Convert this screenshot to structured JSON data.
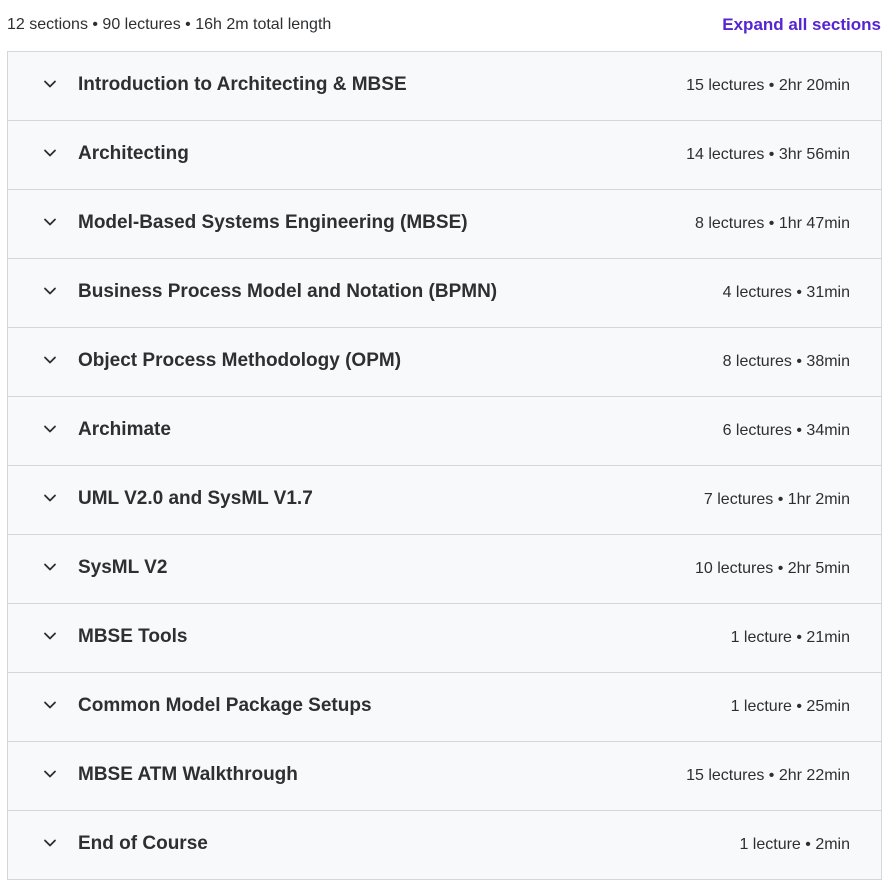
{
  "curriculum": {
    "summary": "12 sections • 90 lectures • 16h 2m total length",
    "expand_label": "Expand all sections",
    "sections": [
      {
        "title": "Introduction to Architecting & MBSE",
        "meta": "15 lectures • 2hr 20min"
      },
      {
        "title": "Architecting",
        "meta": "14 lectures • 3hr 56min"
      },
      {
        "title": "Model-Based Systems Engineering (MBSE)",
        "meta": "8 lectures • 1hr 47min"
      },
      {
        "title": "Business Process Model and Notation (BPMN)",
        "meta": "4 lectures • 31min"
      },
      {
        "title": "Object Process Methodology (OPM)",
        "meta": "8 lectures • 38min"
      },
      {
        "title": "Archimate",
        "meta": "6 lectures • 34min"
      },
      {
        "title": "UML V2.0 and SysML V1.7",
        "meta": "7 lectures • 1hr 2min"
      },
      {
        "title": "SysML V2",
        "meta": "10 lectures • 2hr 5min"
      },
      {
        "title": "MBSE Tools",
        "meta": "1 lecture • 21min"
      },
      {
        "title": "Common Model Package Setups",
        "meta": "1 lecture • 25min"
      },
      {
        "title": "MBSE ATM Walkthrough",
        "meta": "15 lectures • 2hr 22min"
      },
      {
        "title": "End of Course",
        "meta": "1 lecture • 2min"
      }
    ]
  },
  "colors": {
    "link": "#5624d0",
    "panel_bg": "#f7f9fa",
    "border": "#d1d7dc",
    "text": "#2d2f31"
  },
  "icons": {
    "section_toggle": "chevron-down-icon"
  }
}
